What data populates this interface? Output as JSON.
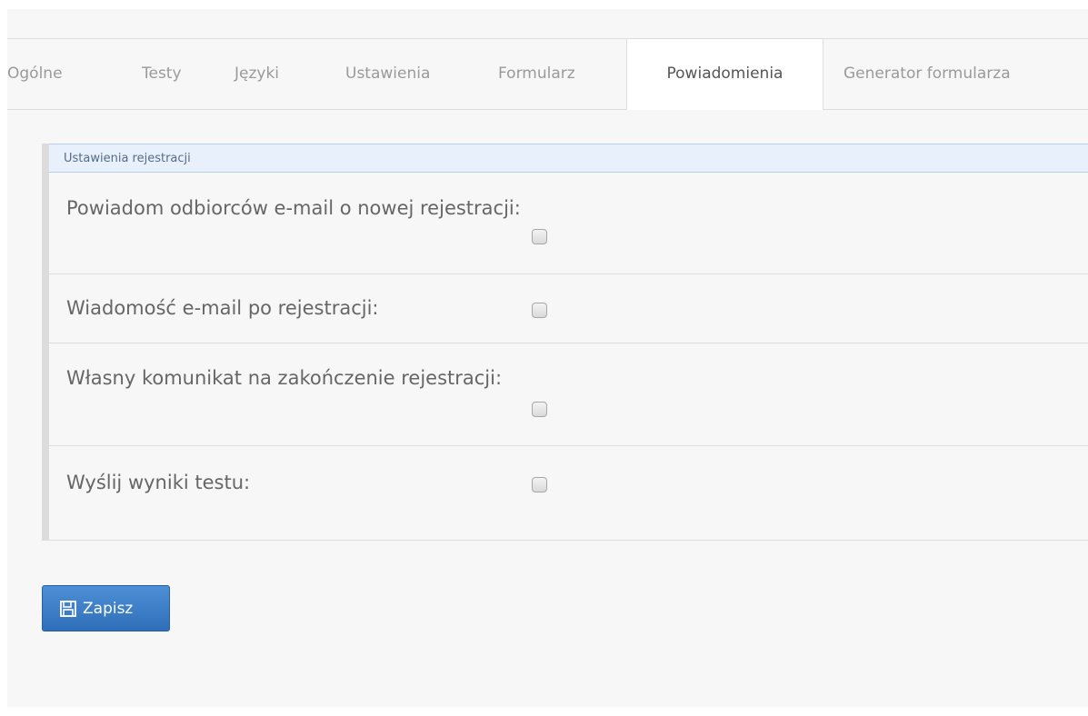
{
  "tabs": [
    {
      "label": "Ogólne"
    },
    {
      "label": "Testy"
    },
    {
      "label": "Języki"
    },
    {
      "label": "Ustawienia"
    },
    {
      "label": "Formularz"
    },
    {
      "label": "Powiadomienia"
    },
    {
      "label": "Generator formularza"
    }
  ],
  "active_tab": "Powiadomienia",
  "panel": {
    "header": "Ustawienia rejestracji",
    "rows": [
      {
        "label": "Powiadom odbiorców e-mail o nowej rejestracji:",
        "checked": false
      },
      {
        "label": "Wiadomość e-mail po rejestracji:",
        "checked": false
      },
      {
        "label": "Własny komunikat na zakończenie rejestracji:",
        "checked": false
      },
      {
        "label": "Wyślij wyniki testu:",
        "checked": false
      }
    ]
  },
  "actions": {
    "save_label": "Zapisz",
    "save_icon": "floppy-disk-icon"
  },
  "colors": {
    "accent": "#337ab7",
    "panel_header_bg": "#e8f1fb"
  }
}
